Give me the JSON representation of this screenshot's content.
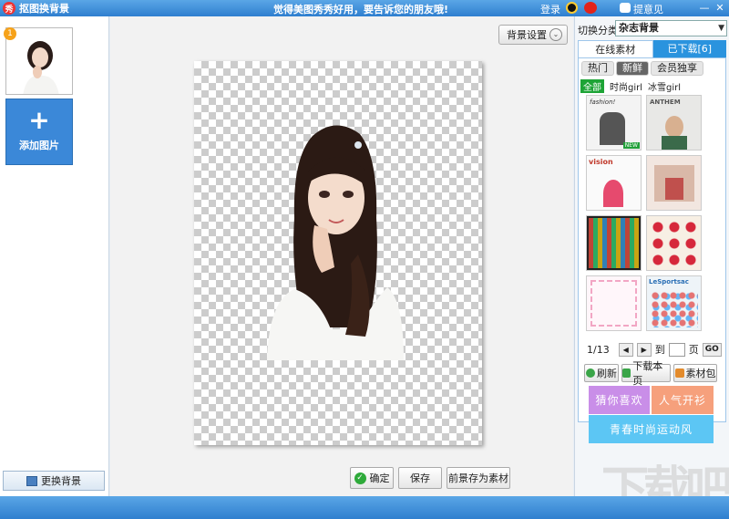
{
  "titlebar": {
    "app_icon": "秀",
    "title": "抠图换背景",
    "banner": "觉得美图秀秀好用，要告诉您的朋友哦!",
    "login": "登录",
    "feedback": "提意见",
    "minimize": "—",
    "close": "✕"
  },
  "left": {
    "thumb_badge": "1",
    "add_plus": "+",
    "add_label": "添加图片",
    "replace_bg": "更换背景"
  },
  "center": {
    "bg_settings": "背景设置",
    "chevron": "⌄",
    "confirm": "确定",
    "confirm_icon": "✓",
    "save": "保存",
    "save_as_material": "前景存为素材"
  },
  "right": {
    "category_label": "切换分类",
    "category_value": "杂志背景",
    "tab_online": "在线素材",
    "tab_downloaded": "已下载[6]",
    "subtabs": [
      "热门",
      "新鲜",
      "会员独享"
    ],
    "filters": [
      "全部",
      "时尚girl",
      "冰雪girl"
    ],
    "thumbs": [
      "fashion!",
      "ANTHEM",
      "vision",
      "",
      "",
      "",
      "",
      "LeSportsac"
    ],
    "new_badge": "NEW",
    "page_info": "1/13",
    "prev": "◀",
    "next": "▶",
    "goto_label": "到",
    "page_suffix": "页",
    "go": "GO",
    "refresh": "刷新",
    "download_page": "下载本页",
    "material_pack": "素材包",
    "promo1": "猜你喜欢",
    "promo2": "人气开衫",
    "promo3": "青春时尚运动风"
  },
  "watermark": "下载吧",
  "colors": {
    "title_bar": "#2f7fcf",
    "add_button": "#3b88d8",
    "tab_active_bg": "#2a93de",
    "filter_active": "#1ea436",
    "promo_purple": "#c98ee8",
    "promo_orange": "#f6a07c",
    "promo_blue": "#5cc6f4"
  }
}
